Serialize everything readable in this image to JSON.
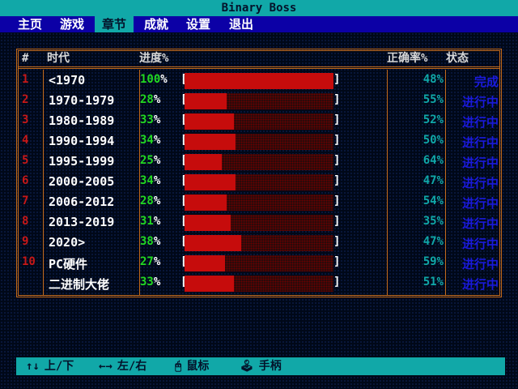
{
  "app": {
    "title": "Binary Boss"
  },
  "menu": [
    {
      "label": "主页",
      "active": false
    },
    {
      "label": "游戏",
      "active": false
    },
    {
      "label": "章节",
      "active": true
    },
    {
      "label": "成就",
      "active": false
    },
    {
      "label": "设置",
      "active": false
    },
    {
      "label": "退出",
      "active": false
    }
  ],
  "table": {
    "headers": {
      "num": "#",
      "era": "时代",
      "progress": "进度%",
      "accuracy": "正确率%",
      "status": "状态"
    },
    "rows": [
      {
        "num": "1",
        "era": "<1970",
        "progress": 100,
        "accuracy": "48%",
        "status": "完成"
      },
      {
        "num": "2",
        "era": "1970-1979",
        "progress": 28,
        "accuracy": "55%",
        "status": "进行中"
      },
      {
        "num": "3",
        "era": "1980-1989",
        "progress": 33,
        "accuracy": "52%",
        "status": "进行中"
      },
      {
        "num": "4",
        "era": "1990-1994",
        "progress": 34,
        "accuracy": "50%",
        "status": "进行中"
      },
      {
        "num": "5",
        "era": "1995-1999",
        "progress": 25,
        "accuracy": "64%",
        "status": "进行中"
      },
      {
        "num": "6",
        "era": "2000-2005",
        "progress": 34,
        "accuracy": "47%",
        "status": "进行中"
      },
      {
        "num": "7",
        "era": "2006-2012",
        "progress": 28,
        "accuracy": "54%",
        "status": "进行中"
      },
      {
        "num": "8",
        "era": "2013-2019",
        "progress": 31,
        "accuracy": "35%",
        "status": "进行中"
      },
      {
        "num": "9",
        "era": "2020>",
        "progress": 38,
        "accuracy": "47%",
        "status": "进行中"
      },
      {
        "num": "10",
        "era": "PC硬件",
        "progress": 27,
        "accuracy": "59%",
        "status": "进行中"
      },
      {
        "num": "",
        "era": "二进制大佬",
        "progress": 33,
        "accuracy": "51%",
        "status": "进行中"
      }
    ]
  },
  "hints": [
    {
      "icon": "↑↓",
      "label": "上/下"
    },
    {
      "icon": "←→",
      "label": "左/右"
    },
    {
      "icon": "🖰",
      "label": "鼠标"
    },
    {
      "icon": "🕹",
      "label": "手柄"
    }
  ],
  "colors": {
    "accent": "#11a8a8",
    "menu_bg": "#0c00a6",
    "border": "#c36a1a",
    "bar_fill": "#c60c0c",
    "progress_value": "#22d822"
  }
}
